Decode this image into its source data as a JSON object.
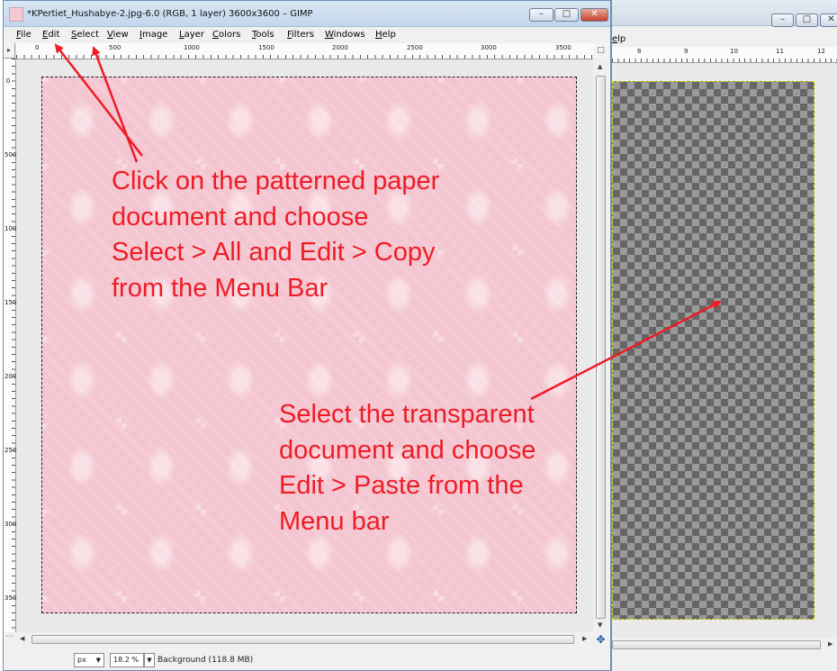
{
  "left_window": {
    "title": "*KPertiet_Hushabye-2.jpg-6.0 (RGB, 1 layer) 3600x3600 – GIMP",
    "menu": [
      "File",
      "Edit",
      "Select",
      "View",
      "Image",
      "Layer",
      "Colors",
      "Tools",
      "Filters",
      "Windows",
      "Help"
    ],
    "ruler_h_labels": [
      "0",
      "500",
      "1000",
      "1500",
      "2000",
      "2500",
      "3000",
      "3500"
    ],
    "ruler_v_labels": [
      "0",
      "500",
      "1000",
      "1500",
      "2000",
      "2500",
      "3000",
      "3500"
    ],
    "status": {
      "unit": "px",
      "zoom": "18.2 %",
      "layer_info": "Background (118.8 MB)"
    }
  },
  "right_window": {
    "menu_fragment": "elp",
    "ruler_labels": [
      "8",
      "9",
      "10",
      "11",
      "12"
    ]
  },
  "annotations": {
    "note1": [
      "Click on the patterned paper",
      "document and choose",
      "Select > All and Edit > Copy",
      "from the Menu Bar"
    ],
    "note2": [
      "Select the transparent",
      "document and choose",
      "Edit > Paste from the",
      "Menu bar"
    ],
    "arrow_color": "#ee1c25"
  }
}
